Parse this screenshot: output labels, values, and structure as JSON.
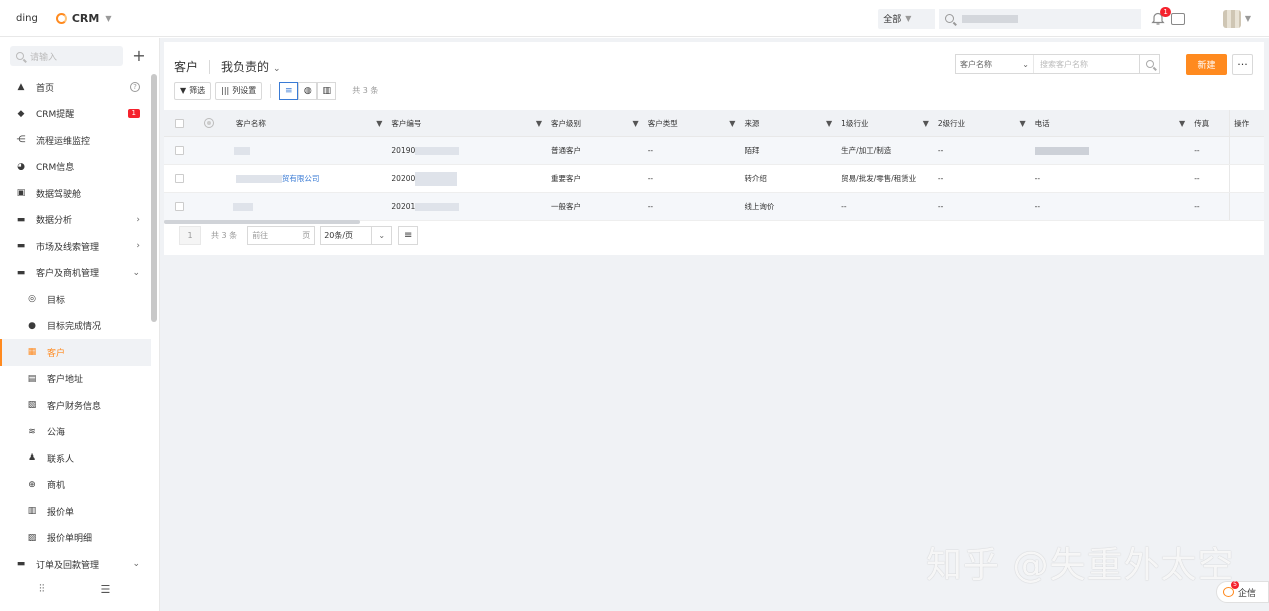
{
  "topbar": {
    "org": "ding",
    "app_name": "CRM",
    "scope": "全部",
    "notification_count": "1"
  },
  "sidebar": {
    "search_placeholder": "请输入",
    "add_label": "+",
    "home_badge": "?",
    "crm_alert_badge": "1",
    "items": [
      {
        "label": "首页"
      },
      {
        "label": "CRM提醒"
      },
      {
        "label": "流程运维监控"
      },
      {
        "label": "CRM信息"
      },
      {
        "label": "数据驾驶舱"
      },
      {
        "label": "数据分析"
      },
      {
        "label": "市场及线索管理"
      },
      {
        "label": "客户及商机管理"
      },
      {
        "label": "目标"
      },
      {
        "label": "目标完成情况"
      },
      {
        "label": "客户"
      },
      {
        "label": "客户地址"
      },
      {
        "label": "客户财务信息"
      },
      {
        "label": "公海"
      },
      {
        "label": "联系人"
      },
      {
        "label": "商机"
      },
      {
        "label": "报价单"
      },
      {
        "label": "报价单明细"
      },
      {
        "label": "订单及回款管理"
      }
    ]
  },
  "main": {
    "breadcrumb": "客户",
    "view_name": "我负责的",
    "search_field_type": "客户名称",
    "search_placeholder": "搜索客户名称",
    "new_label": "新建",
    "more_label": "···",
    "filter_label": "筛选",
    "columns_label": "列设置",
    "total_label": "共 3 条"
  },
  "table": {
    "headers": {
      "name": "客户名称",
      "number": "客户编号",
      "level": "客户级别",
      "type": "客户类型",
      "source": "来源",
      "industry1": "1级行业",
      "industry2": "2级行业",
      "phone": "电话",
      "fax": "传真",
      "action": "操作"
    },
    "rows": [
      {
        "name": "",
        "number": "20190",
        "level": "普通客户",
        "type": "--",
        "source": "陌拜",
        "industry1": "生产/加工/制造",
        "industry2": "--",
        "phone": "",
        "fax": "--"
      },
      {
        "name": "贸有限公司",
        "number": "20200",
        "level": "重要客户",
        "type": "--",
        "source": "转介绍",
        "industry1": "贸易/批发/零售/租赁业",
        "industry2": "--",
        "phone": "--",
        "fax": "--"
      },
      {
        "name": "",
        "number": "20201",
        "level": "一般客户",
        "type": "--",
        "source": "线上询价",
        "industry1": "--",
        "industry2": "--",
        "phone": "--",
        "fax": "--"
      }
    ]
  },
  "pager": {
    "current": "1",
    "total": "共 3 条",
    "goto_prefix": "前往",
    "goto_suffix": "页",
    "page_size": "20条/页"
  },
  "watermark": "知乎 @失重外太空",
  "qixin": {
    "label": "企信",
    "badge": "5"
  }
}
